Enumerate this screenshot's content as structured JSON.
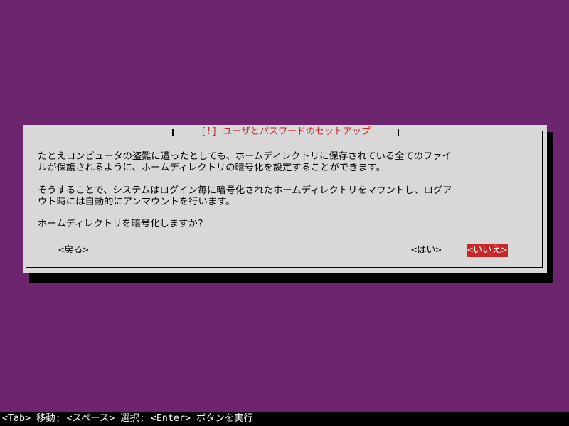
{
  "dialog": {
    "title": "[!] ユーザとパスワードのセットアップ",
    "paragraph1_line1": "たとえコンピュータの盗難に遭ったとしても、ホームディレクトリに保存されている全てのファイ",
    "paragraph1_line2": "ルが保護されるように、ホームディレクトリの暗号化を設定することができます。",
    "paragraph2_line1": "そうすることで、システムはログイン毎に暗号化されたホームディレクトリをマウントし、ログア",
    "paragraph2_line2": "ウト時には自動的にアンマウントを行います。",
    "question": "ホームディレクトリを暗号化しますか?",
    "buttons": {
      "back": "<戻る>",
      "yes": "<はい>",
      "no": "<いいえ>"
    }
  },
  "statusbar": {
    "text": "<Tab> 移動; <スペース> 選択; <Enter> ボタンを実行"
  },
  "colors": {
    "background": "#6d2570",
    "dialog": "#d8d8d8",
    "accent": "#c82828",
    "statusbar": "#000000"
  }
}
